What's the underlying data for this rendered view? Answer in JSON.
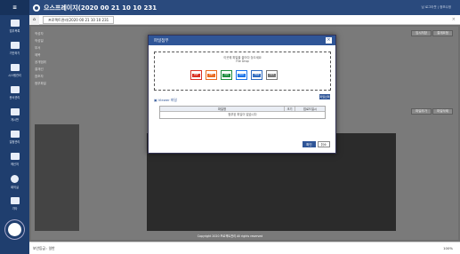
{
  "app": {
    "title": "으스프레이지(2020 00 21 10 10 231",
    "header_right": "님 로그아웃 | 정보수정"
  },
  "sidebar": {
    "items": [
      {
        "label": "업무목록"
      },
      {
        "label": "기안하기"
      },
      {
        "label": "시스템관리"
      },
      {
        "label": "문서관리"
      },
      {
        "label": "게시판"
      },
      {
        "label": "일정관리"
      },
      {
        "label": "메신저"
      },
      {
        "label": "회의실"
      },
      {
        "label": "기타"
      }
    ]
  },
  "tabs": [
    {
      "label": "프로젝트관리(2020 00 21 10 10 231"
    }
  ],
  "form_labels": [
    "작성자",
    "작성일",
    "부서",
    "제목",
    "공개범위",
    "결재선",
    "참조자",
    "첨부파일"
  ],
  "content_buttons": {
    "save": "임시저장",
    "submit": "결재요청",
    "add_file": "파일추가",
    "delete_file": "파일삭제"
  },
  "modal": {
    "title": "파일첨부",
    "dropzone_line1": "이곳에 파일을 끌어다 놓으세요",
    "dropzone_line2": "File Drop",
    "file_types": [
      {
        "name": "PDF",
        "color": "#d93025"
      },
      {
        "name": "PPT",
        "color": "#e86a1f"
      },
      {
        "name": "XLS",
        "color": "#1e8e3e"
      },
      {
        "name": "DOC",
        "color": "#1a73e8"
      },
      {
        "name": "HWP",
        "color": "#2f6bbf"
      },
      {
        "name": "TXT",
        "color": "#777777"
      }
    ],
    "attach_label": "Viewer 파일",
    "attach_button": "파일선택",
    "grid_headers": [
      "파일명",
      "크기",
      "업로드일시"
    ],
    "grid_empty": "첨부된 파일이 없습니다",
    "confirm": "확인",
    "cancel": "취소"
  },
  "footer_note": "Copyright 2020 프로젝트관리 All rights reserved",
  "status": {
    "left": "보안등급 : 일반",
    "zoom": "100%"
  }
}
